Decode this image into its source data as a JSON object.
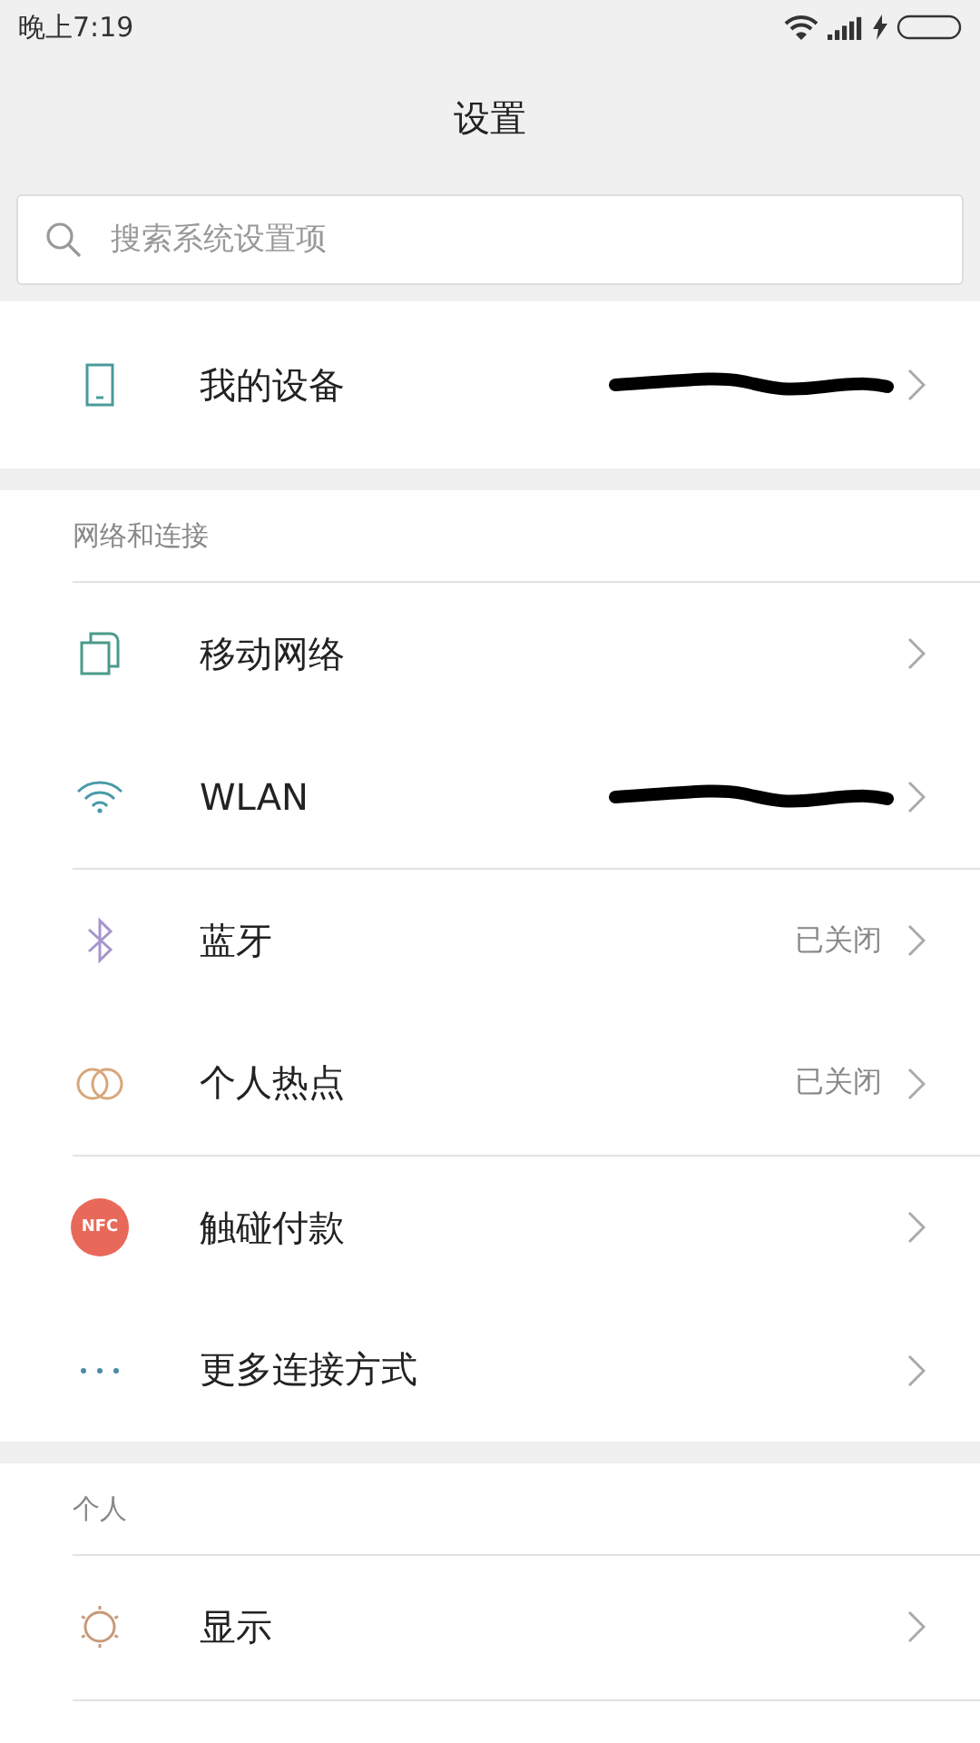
{
  "status_bar": {
    "time": "晚上7:19"
  },
  "title": "设置",
  "search": {
    "placeholder": "搜索系统设置项"
  },
  "groups": [
    {
      "items": [
        {
          "kind": "phone",
          "label": "我的设备",
          "redacted": true
        }
      ]
    },
    {
      "header": "网络和连接",
      "items": [
        {
          "kind": "sim",
          "label": "移动网络"
        },
        {
          "kind": "wifi",
          "label": "WLAN",
          "redacted": true
        },
        {
          "kind": "bluetooth",
          "label": "蓝牙",
          "value": "已关闭"
        },
        {
          "kind": "hotspot",
          "label": "个人热点",
          "value": "已关闭"
        },
        {
          "kind": "nfc",
          "label": "触碰付款",
          "icon_text": "NFC"
        },
        {
          "kind": "more",
          "label": "更多连接方式"
        }
      ]
    },
    {
      "header": "个人",
      "items": [
        {
          "kind": "sun",
          "label": "显示"
        }
      ]
    }
  ]
}
